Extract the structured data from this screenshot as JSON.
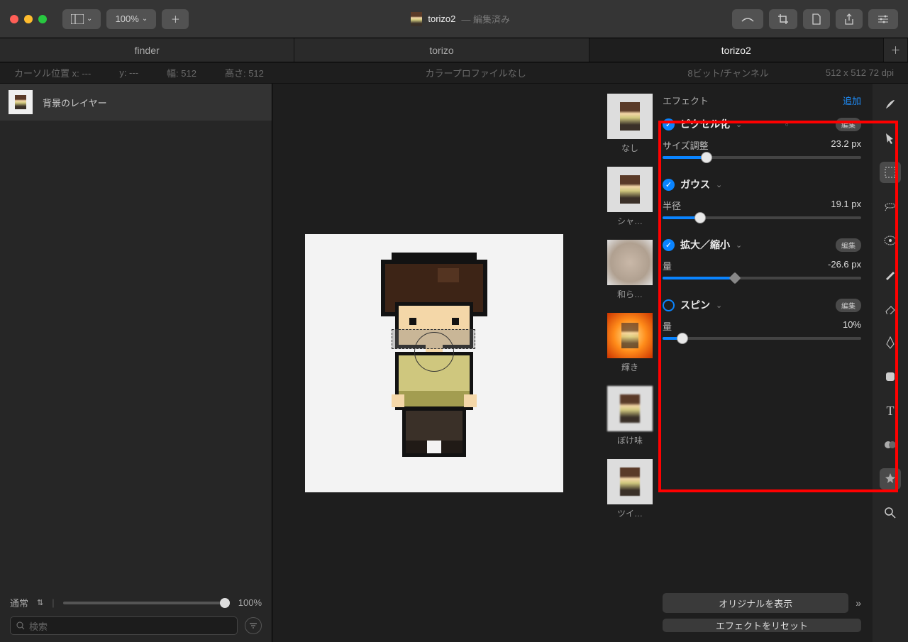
{
  "titlebar": {
    "zoom": "100%",
    "title": "torizo2",
    "status": "— 編集済み"
  },
  "tabs": [
    "finder",
    "torizo",
    "torizo2"
  ],
  "active_tab": 2,
  "info": {
    "cursor": "カーソル位置 x: ---",
    "cursor_y": "y: ---",
    "width": "幅: 512",
    "height": "高さ: 512",
    "color_profile": "カラープロファイルなし",
    "bits": "8ビット/チャンネル",
    "dims": "512 x 512 72 dpi"
  },
  "layers": {
    "bg": "背景のレイヤー",
    "blend": "通常",
    "opacity": "100%",
    "search_ph": "検索"
  },
  "fx": {
    "header": "エフェクト",
    "add": "追加",
    "edit": "編集",
    "show_original": "オリジナルを表示",
    "reset": "エフェクトをリセット",
    "thumbs": [
      "なし",
      "シャ…",
      "和ら…",
      "輝き",
      "ぼけ味",
      "ツイ…"
    ],
    "groups": [
      {
        "name": "ピクセル化",
        "on": true,
        "edit": true,
        "label": "サイズ調整",
        "value": "23.2 px",
        "pct": 22
      },
      {
        "name": "ガウス",
        "on": true,
        "edit": false,
        "label": "半径",
        "value": "19.1 px",
        "pct": 19
      },
      {
        "name": "拡大／縮小",
        "on": true,
        "edit": true,
        "label": "量",
        "value": "-26.6 px",
        "pct": 37,
        "diamond": true
      },
      {
        "name": "スピン",
        "on": false,
        "edit": true,
        "label": "量",
        "value": "10%",
        "pct": 10
      }
    ]
  }
}
